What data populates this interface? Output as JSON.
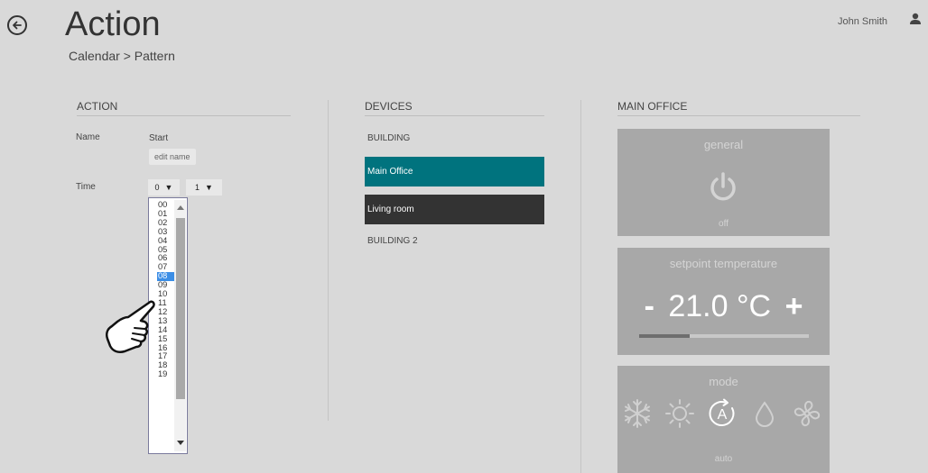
{
  "header": {
    "title": "Action",
    "breadcrumb": "Calendar > Pattern",
    "user_name": "John Smith"
  },
  "action": {
    "heading": "ACTION",
    "name_label": "Name",
    "name_value": "Start",
    "edit_name_label": "edit name",
    "time_label": "Time",
    "hour_value": "0",
    "minute_value": "1",
    "hour_options": [
      "00",
      "01",
      "02",
      "03",
      "04",
      "05",
      "06",
      "07",
      "08",
      "09",
      "10",
      "11",
      "12",
      "13",
      "14",
      "15",
      "16",
      "17",
      "18",
      "19"
    ],
    "highlighted_option": "08"
  },
  "devices": {
    "heading": "DEVICES",
    "items": [
      {
        "label": "BUILDING"
      },
      {
        "label": "Main Office"
      },
      {
        "label": "Living room"
      },
      {
        "label": "BUILDING 2"
      }
    ]
  },
  "main_office": {
    "heading": "MAIN OFFICE",
    "general": {
      "title": "general",
      "state": "off"
    },
    "setpoint": {
      "title": "setpoint temperature",
      "minus": "-",
      "value": "21.0 °C",
      "plus": "+",
      "level": 0.3
    },
    "mode": {
      "title": "mode",
      "state": "auto",
      "icons": [
        "snowflake-icon",
        "sun-icon",
        "auto-mode-icon",
        "drop-icon",
        "fan-icon"
      ]
    }
  },
  "colors": {
    "background": "#d9d9d9",
    "selected_device": "#00737e",
    "dark_device": "#333333",
    "tile": "#a8a8a8",
    "list_highlight": "#3c8ee6"
  }
}
